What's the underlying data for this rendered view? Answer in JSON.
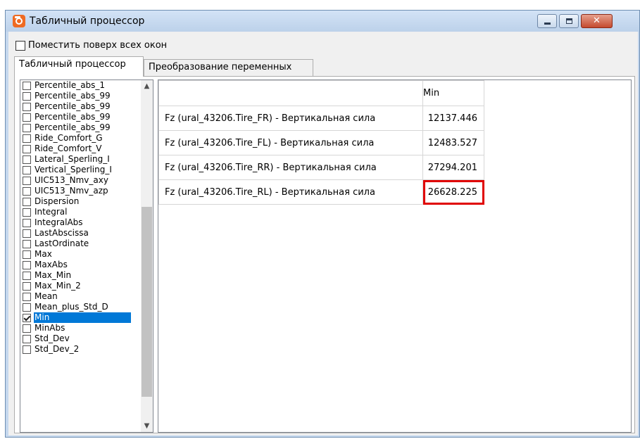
{
  "window": {
    "title": "Табличный процессор",
    "controls": {
      "minimize_icon": "minimize-icon",
      "maximize_icon": "maximize-icon",
      "close_label": "✕"
    }
  },
  "options": {
    "always_on_top_label": "Поместить поверх всех окон",
    "always_on_top_checked": false
  },
  "tabs": [
    {
      "label": "Табличный процессор",
      "active": true
    },
    {
      "label": "Преобразование переменных",
      "active": false
    }
  ],
  "function_list": {
    "items": [
      {
        "label": "Percentile_abs_1",
        "checked": false
      },
      {
        "label": "Percentile_abs_99",
        "checked": false
      },
      {
        "label": "Percentile_abs_99",
        "checked": false
      },
      {
        "label": "Percentile_abs_99",
        "checked": false
      },
      {
        "label": "Percentile_abs_99",
        "checked": false
      },
      {
        "label": "Ride_Comfort_G",
        "checked": false
      },
      {
        "label": "Ride_Comfort_V",
        "checked": false
      },
      {
        "label": "Lateral_Sperling_I",
        "checked": false
      },
      {
        "label": "Vertical_Sperling_I",
        "checked": false
      },
      {
        "label": "UIC513_Nmv_axy",
        "checked": false
      },
      {
        "label": "UIC513_Nmv_azp",
        "checked": false
      },
      {
        "label": "Dispersion",
        "checked": false
      },
      {
        "label": "Integral",
        "checked": false
      },
      {
        "label": "IntegralAbs",
        "checked": false
      },
      {
        "label": "LastAbscissa",
        "checked": false
      },
      {
        "label": "LastOrdinate",
        "checked": false
      },
      {
        "label": "Max",
        "checked": false
      },
      {
        "label": "MaxAbs",
        "checked": false
      },
      {
        "label": "Max_Min",
        "checked": false
      },
      {
        "label": "Max_Min_2",
        "checked": false
      },
      {
        "label": "Mean",
        "checked": false
      },
      {
        "label": "Mean_plus_Std_D",
        "checked": false
      },
      {
        "label": "Min",
        "checked": true,
        "selected": true
      },
      {
        "label": "MinAbs",
        "checked": false
      },
      {
        "label": "Std_Dev",
        "checked": false
      },
      {
        "label": "Std_Dev_2",
        "checked": false
      }
    ],
    "scroll_up_glyph": "▲",
    "scroll_down_glyph": "▼"
  },
  "results_table": {
    "columns": [
      "",
      "Min"
    ],
    "rows": [
      {
        "name": "Fz (ural_43206.Tire_FR) - Вертикальная сила",
        "value": "12137.446"
      },
      {
        "name": "Fz (ural_43206.Tire_FL) - Вертикальная сила",
        "value": "12483.527"
      },
      {
        "name": "Fz (ural_43206.Tire_RR) - Вертикальная сила",
        "value": "27294.201"
      },
      {
        "name": "Fz (ural_43206.Tire_RL) - Вертикальная сила",
        "value": "26628.225",
        "highlighted": true
      }
    ]
  },
  "colors": {
    "selection": "#0078d7",
    "highlight_border": "#e00000",
    "app_icon": "#ef6a22",
    "close_button": "#c44a2f"
  }
}
